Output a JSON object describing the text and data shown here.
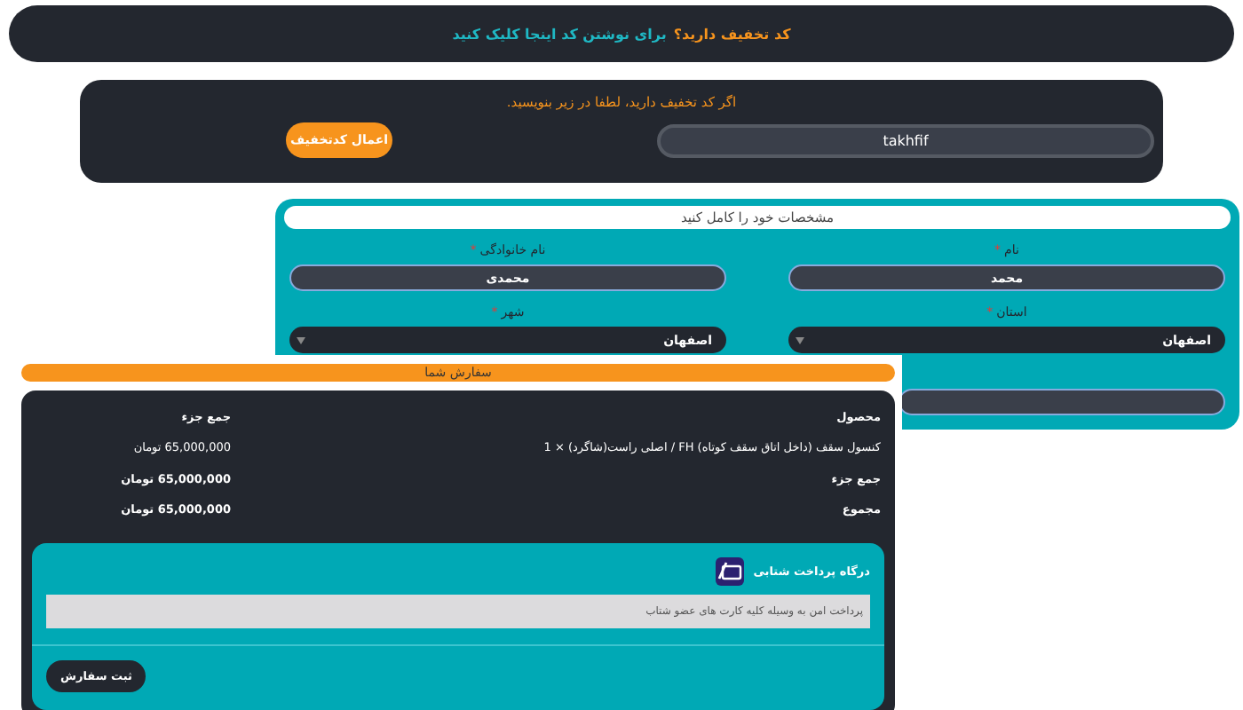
{
  "discount_bar": {
    "question": "کد تخفیف دارید؟",
    "link": "برای نوشتن کد اینجا کلیک کنید"
  },
  "coupon": {
    "hint": "اگر کد تخفیف دارید، لطفا در زیر بنویسید.",
    "code": "takhfif",
    "button": "اعمال کدتخفیف"
  },
  "details": {
    "title": "مشخصات خود را کامل کنید",
    "fields": [
      {
        "kind": "text",
        "label": "نام",
        "mark": "*",
        "value": "محمد"
      },
      {
        "kind": "text",
        "label": "نام خانوادگی",
        "mark": "*",
        "value": "محمدی"
      },
      {
        "kind": "select",
        "label": "استان",
        "mark": "*",
        "value": "اصفهان"
      },
      {
        "kind": "select",
        "label": "شهر",
        "mark": "*",
        "value": "اصفهان"
      },
      {
        "kind": "text"
      }
    ]
  },
  "order": {
    "title": "سفارش شما",
    "columns": [
      "محصول",
      "جمع جزء"
    ],
    "rows": [
      {
        "kind": "item",
        "label": "کنسول سقف (داخل اتاق سقف کوتاه) FH / اصلی راست(شاگرد)  × 1",
        "value": "65,000,000 تومان"
      },
      {
        "kind": "total",
        "label": "جمع جزء",
        "value": "65,000,000 تومان"
      },
      {
        "kind": "total",
        "label": "مجموع",
        "value": "65,000,000 تومان"
      }
    ],
    "payment": {
      "method": "درگاه پرداخت شتابی",
      "description": "پرداخت امن به وسیله کلیه کارت های عضو شتاب",
      "button": "ثبت سفارش"
    }
  }
}
